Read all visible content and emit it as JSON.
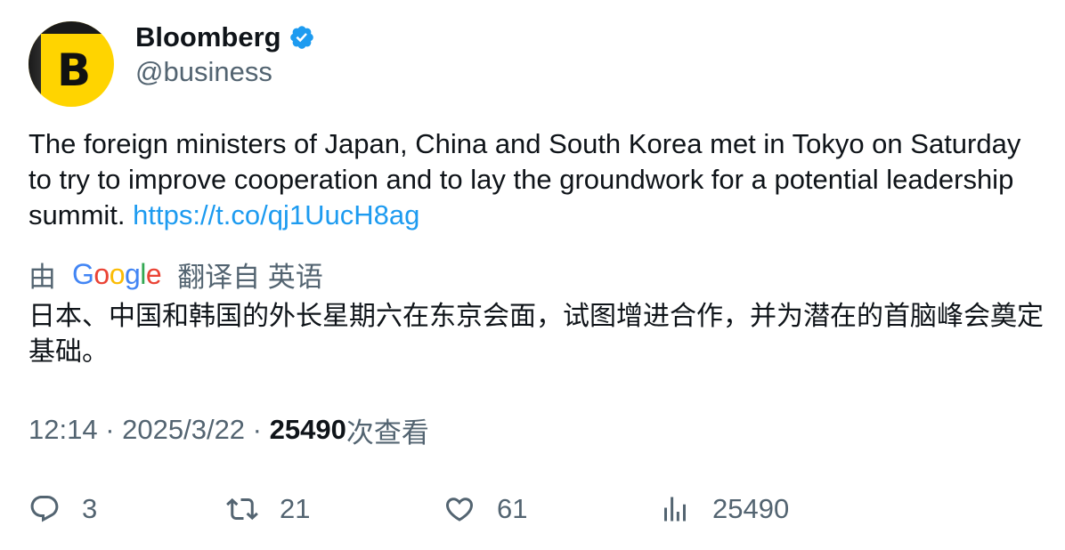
{
  "author": {
    "name": "Bloomberg",
    "handle": "@business",
    "avatar_letter": "B",
    "verified": true,
    "avatar_color": "#ffd400"
  },
  "tweet": {
    "text": "The foreign ministers of Japan, China and South Korea met in Tokyo on Saturday to try to improve cooperation and to lay the groundwork for a potential leadership summit. ",
    "link": "https://t.co/qj1UucH8ag"
  },
  "translation": {
    "prefix": "由",
    "provider": "Google",
    "suffix": "翻译自 英语",
    "text": "日本、中国和韩国的外长星期六在东京会面，试图增进合作，并为潜在的首脑峰会奠定基础。"
  },
  "meta": {
    "time": "12:14",
    "separator": " · ",
    "date": "2025/3/22",
    "views_count": "25490",
    "views_label": "次查看"
  },
  "actions": {
    "replies": "3",
    "retweets": "21",
    "likes": "61",
    "views": "25490"
  },
  "colors": {
    "link": "#1d9bf0",
    "secondary": "#536471",
    "primary_text": "#0f1419",
    "verified": "#1d9bf0"
  },
  "google_letters": [
    {
      "char": "G",
      "color": "#4285f4"
    },
    {
      "char": "o",
      "color": "#ea4335"
    },
    {
      "char": "o",
      "color": "#fbbc05"
    },
    {
      "char": "g",
      "color": "#4285f4"
    },
    {
      "char": "l",
      "color": "#34a853"
    },
    {
      "char": "e",
      "color": "#ea4335"
    }
  ]
}
